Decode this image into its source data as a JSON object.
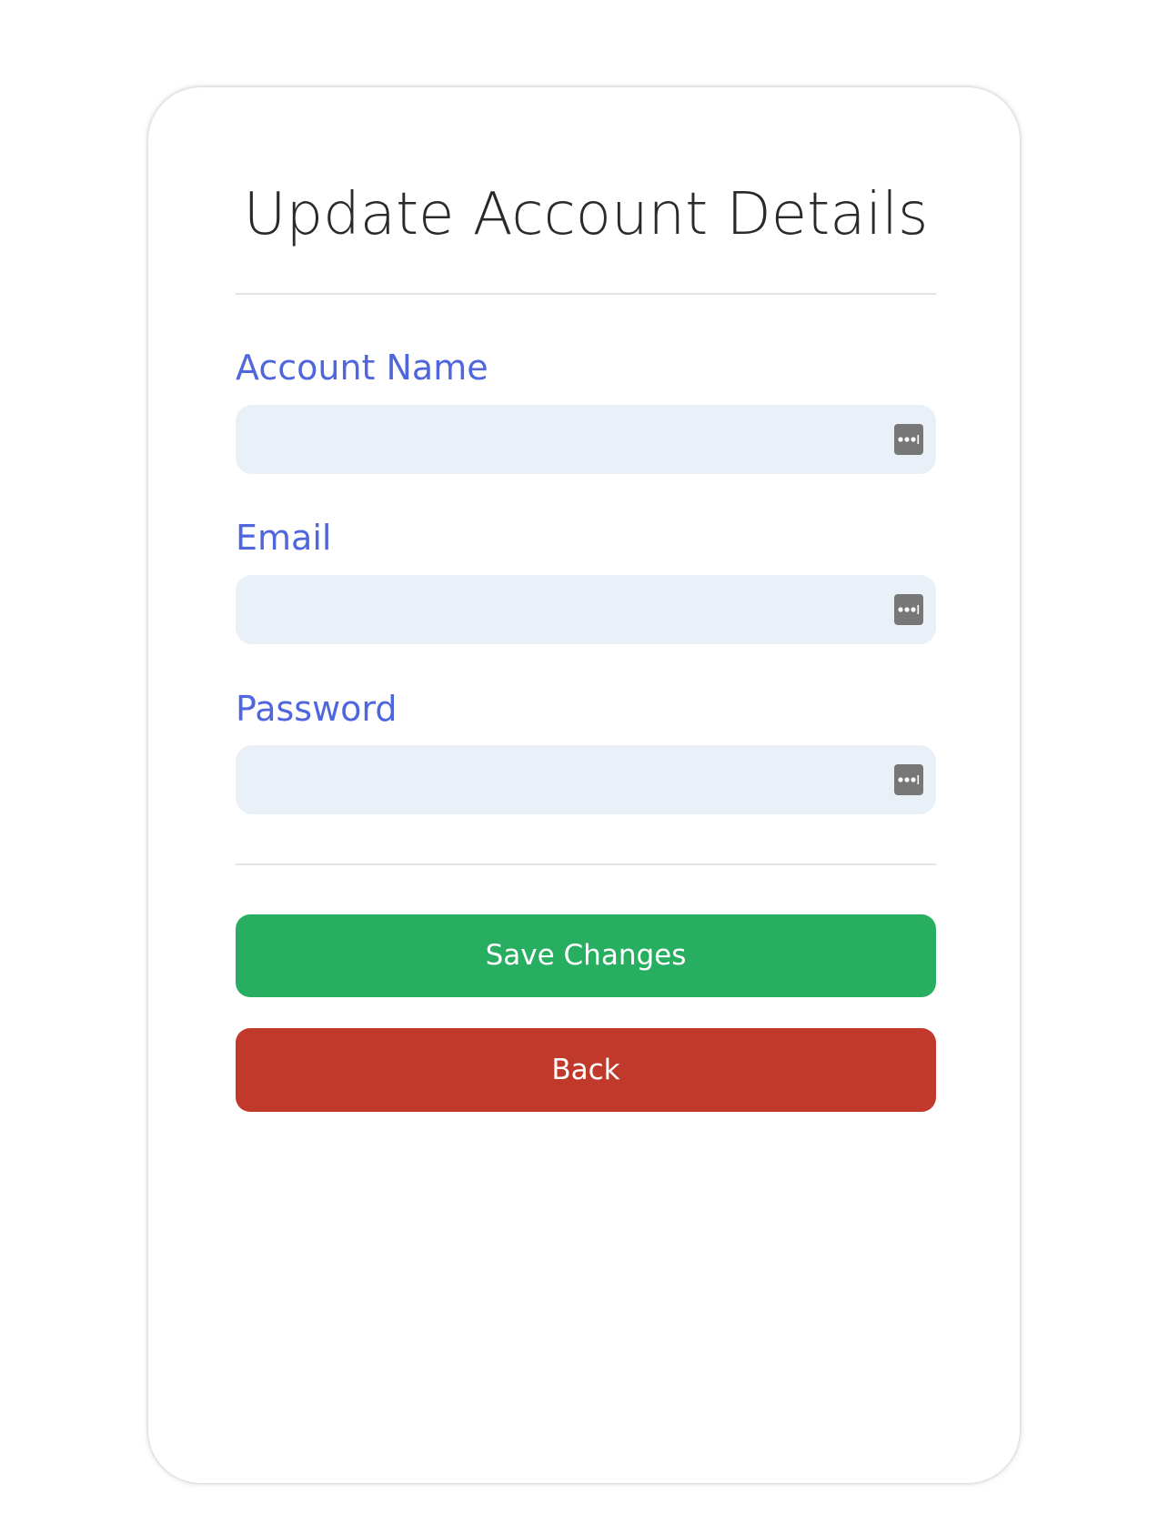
{
  "form": {
    "title": "Update Account Details",
    "fields": [
      {
        "label": "Account Name",
        "value": "",
        "placeholder": "",
        "icon": "password-manager-icon"
      },
      {
        "label": "Email",
        "value": "",
        "placeholder": "",
        "icon": "password-manager-icon"
      },
      {
        "label": "Password",
        "value": "",
        "placeholder": "",
        "icon": "password-manager-icon"
      }
    ],
    "save_label": "Save Changes",
    "back_label": "Back"
  },
  "colors": {
    "label": "#5066dc",
    "field_bg": "#e9f0f7",
    "save": "#27ae60",
    "back": "#c0392b"
  }
}
